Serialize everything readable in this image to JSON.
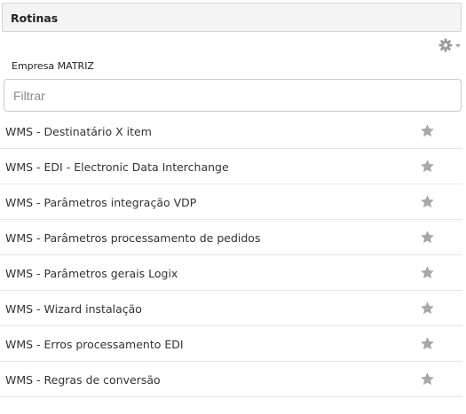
{
  "header": {
    "title": "Rotinas"
  },
  "toolbar": {
    "settings_icon": "gear-icon",
    "dropdown_icon": "caret-down-icon"
  },
  "company": {
    "label": "Empresa MATRIZ"
  },
  "filter": {
    "placeholder": "Filtrar",
    "value": ""
  },
  "routines": [
    {
      "label": "WMS - Destinatário X item",
      "favorite_icon": "star-icon"
    },
    {
      "label": "WMS - EDI - Electronic Data Interchange",
      "favorite_icon": "star-icon"
    },
    {
      "label": "WMS - Parâmetros integração VDP",
      "favorite_icon": "star-icon"
    },
    {
      "label": "WMS - Parâmetros processamento de pedidos",
      "favorite_icon": "star-icon"
    },
    {
      "label": "WMS - Parâmetros gerais Logix",
      "favorite_icon": "star-icon"
    },
    {
      "label": "WMS - Wizard instalação",
      "favorite_icon": "star-icon"
    },
    {
      "label": "WMS - Erros processamento EDI",
      "favorite_icon": "star-icon"
    },
    {
      "label": "WMS - Regras de conversão",
      "favorite_icon": "star-icon"
    }
  ],
  "colors": {
    "header_bg": "#f4f4f4",
    "border": "#d5d5d5",
    "icon_gray": "#9a9a9a",
    "text": "#333333"
  }
}
